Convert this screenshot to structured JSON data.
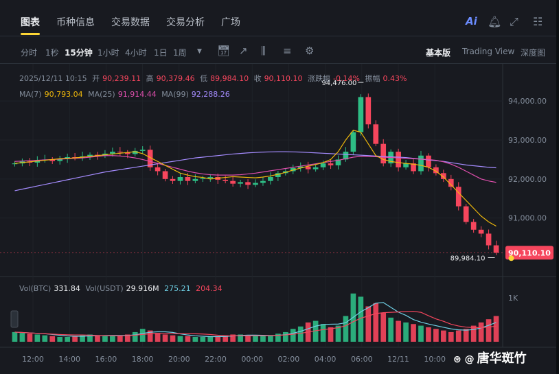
{
  "tabs": {
    "items": [
      "图表",
      "币种信息",
      "交易数据",
      "交易分析",
      "广场"
    ],
    "active": "图表"
  },
  "header_icons": {
    "ai_label": "Ai"
  },
  "toolbar": {
    "intervals": [
      "分时",
      "1秒",
      "15分钟",
      "1小时",
      "4小时",
      "1日",
      "1周"
    ],
    "active_interval": "15分钟",
    "views": [
      "基本版",
      "Trading View",
      "深度图"
    ],
    "active_view": "基本版"
  },
  "ohlc": {
    "date": "2025/12/11 10:15",
    "open_label": "开",
    "open": "90,239.11",
    "high_label": "高",
    "high": "90,379.46",
    "low_label": "低",
    "low": "89,984.10",
    "close_label": "收",
    "close": "90,110.10",
    "change_label": "涨跌幅",
    "change": "-0.14%",
    "amp_label": "振幅",
    "amp": "0.43%"
  },
  "ma": {
    "ma7_label": "MA(7)",
    "ma7": "90,793.04",
    "ma25_label": "MA(25)",
    "ma25": "91,914.44",
    "ma99_label": "MA(99)",
    "ma99": "92,288.26"
  },
  "volume": {
    "btc_label": "Vol(BTC)",
    "btc": "331.84",
    "usdt_label": "Vol(USDT)",
    "usdt": "29.916M",
    "ma1": "275.21",
    "ma2": "204.34"
  },
  "price_axis": {
    "ticks": [
      "94,000.00",
      "93,000.00",
      "92,000.00",
      "91,000.00"
    ],
    "last_price": "90,110.10"
  },
  "volume_axis": {
    "tick": "1K"
  },
  "time_axis": {
    "ticks": [
      "12:00",
      "14:00",
      "16:00",
      "18:00",
      "20:00",
      "22:00",
      "00:00",
      "02:00",
      "04:00",
      "06:00",
      "12/11",
      "10:00"
    ]
  },
  "annotations": {
    "high_marker": "94,476.00",
    "low_marker": "89,984.10"
  },
  "colors": {
    "up": "#2ebd85",
    "down": "#f6465d",
    "ma7": "#f0b90b",
    "ma25": "#e04fae",
    "ma99": "#a58cff",
    "accent": "#fcd535"
  },
  "chart_data": {
    "type": "candlestick",
    "price_range": [
      89500,
      94600
    ],
    "ma7": [
      92400,
      92420,
      92440,
      92460,
      92480,
      92500,
      92520,
      92530,
      92540,
      92560,
      92580,
      92600,
      92620,
      92640,
      92660,
      92680,
      92700,
      92650,
      92550,
      92450,
      92350,
      92250,
      92150,
      92100,
      92060,
      92040,
      92000,
      92020,
      92040,
      92060,
      92050,
      92040,
      92030,
      92050,
      92080,
      92120,
      92170,
      92230,
      92280,
      92330,
      92370,
      92420,
      92500,
      92700,
      93000,
      93250,
      93200,
      92900,
      92600,
      92500,
      92450,
      92420,
      92400,
      92380,
      92350,
      92300,
      92200,
      92050,
      91850,
      91650,
      91450,
      91250,
      91050,
      90900,
      90793
    ],
    "ma25": [
      92450,
      92460,
      92470,
      92480,
      92490,
      92500,
      92510,
      92520,
      92530,
      92540,
      92560,
      92580,
      92600,
      92600,
      92590,
      92570,
      92540,
      92500,
      92450,
      92400,
      92350,
      92300,
      92250,
      92200,
      92160,
      92130,
      92110,
      92100,
      92100,
      92100,
      92110,
      92130,
      92150,
      92180,
      92210,
      92240,
      92270,
      92300,
      92330,
      92360,
      92390,
      92420,
      92450,
      92480,
      92520,
      92560,
      92580,
      92580,
      92570,
      92560,
      92550,
      92540,
      92530,
      92520,
      92510,
      92500,
      92480,
      92440,
      92380,
      92300,
      92200,
      92100,
      92000,
      91950,
      91914
    ],
    "ma99": [
      91700,
      91740,
      91780,
      91820,
      91860,
      91900,
      91940,
      91980,
      92020,
      92060,
      92100,
      92140,
      92180,
      92210,
      92240,
      92270,
      92300,
      92330,
      92360,
      92390,
      92420,
      92450,
      92480,
      92510,
      92540,
      92560,
      92580,
      92600,
      92620,
      92640,
      92655,
      92670,
      92680,
      92690,
      92695,
      92700,
      92700,
      92695,
      92690,
      92680,
      92670,
      92660,
      92650,
      92640,
      92630,
      92620,
      92610,
      92600,
      92590,
      92580,
      92570,
      92560,
      92550,
      92530,
      92510,
      92490,
      92470,
      92450,
      92420,
      92390,
      92360,
      92340,
      92320,
      92300,
      92288
    ],
    "candles_close": [
      92400,
      92450,
      92420,
      92480,
      92500,
      92460,
      92520,
      92560,
      92540,
      92580,
      92620,
      92600,
      92650,
      92700,
      92680,
      92640,
      92720,
      92750,
      92300,
      92200,
      92000,
      91950,
      92050,
      91950,
      92000,
      92020,
      92050,
      91980,
      91950,
      91880,
      91920,
      91850,
      91900,
      91950,
      92050,
      92150,
      92200,
      92280,
      92320,
      92250,
      92300,
      92400,
      92350,
      92500,
      92700,
      93200,
      94100,
      93400,
      92900,
      92400,
      92700,
      92300,
      92400,
      92200,
      92600,
      92300,
      92150,
      92000,
      91800,
      91300,
      90900,
      90700,
      90600,
      90300,
      90110
    ],
    "volume": [
      60,
      55,
      50,
      45,
      40,
      35,
      30,
      30,
      35,
      40,
      45,
      40,
      35,
      35,
      40,
      45,
      60,
      80,
      70,
      55,
      45,
      40,
      35,
      35,
      30,
      30,
      30,
      35,
      40,
      45,
      45,
      40,
      35,
      35,
      40,
      50,
      60,
      80,
      95,
      120,
      130,
      110,
      90,
      100,
      160,
      300,
      280,
      220,
      240,
      180,
      150,
      130,
      120,
      110,
      100,
      90,
      80,
      70,
      60,
      70,
      80,
      100,
      120,
      140,
      160
    ]
  }
}
